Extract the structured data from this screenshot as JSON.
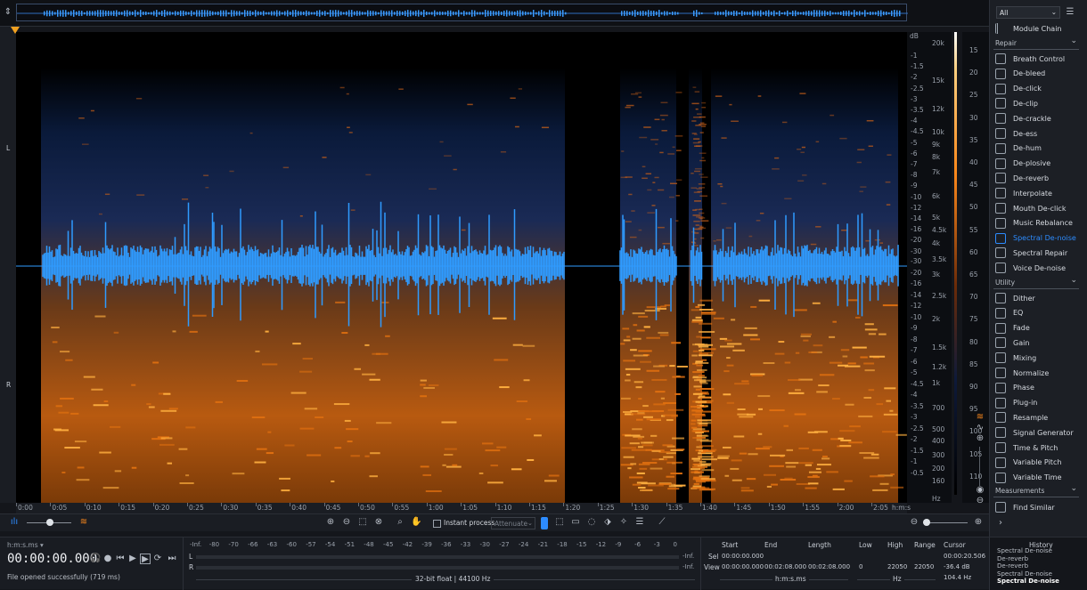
{
  "overview": {
    "toggle_icon": "expand-collapse-icon"
  },
  "channels": {
    "left": "L",
    "right": "R"
  },
  "time_ruler": {
    "ticks": [
      "0:00",
      "0:05",
      "0:10",
      "0:15",
      "0:20",
      "0:25",
      "0:30",
      "0:35",
      "0:40",
      "0:45",
      "0:50",
      "0:55",
      "1:00",
      "1:05",
      "1:10",
      "1:15",
      "1:20",
      "1:25",
      "1:30",
      "1:35",
      "1:40",
      "1:45",
      "1:50",
      "1:55",
      "2:00",
      "2:05"
    ],
    "unit": "h:m:s"
  },
  "db_axis": {
    "header": "dB",
    "upper": [
      "-1",
      "-1.5",
      "-2",
      "-2.5",
      "-3",
      "-3.5",
      "-4",
      "-4.5",
      "-5",
      "-6",
      "-7",
      "-8",
      "-9",
      "-10",
      "-12",
      "-14",
      "-16",
      "-20",
      "-30"
    ],
    "lower": [
      "-30",
      "-20",
      "-16",
      "-14",
      "-12",
      "-10",
      "-9",
      "-8",
      "-7",
      "-6",
      "-5",
      "-4.5",
      "-4",
      "-3.5",
      "-3",
      "-2.5",
      "-2",
      "-1.5",
      "-1",
      "-0.5"
    ]
  },
  "freq_axis": {
    "ticks": [
      "20k",
      "15k",
      "12k",
      "10k",
      "9k",
      "8k",
      "7k",
      "6k",
      "5k",
      "4.5k",
      "4k",
      "3.5k",
      "3k",
      "2.5k",
      "2k",
      "1.5k",
      "1.2k",
      "1k",
      "700",
      "500",
      "400",
      "300",
      "200",
      "160",
      "Hz"
    ]
  },
  "color_scale": {
    "ticks": [
      "15",
      "20",
      "25",
      "30",
      "35",
      "40",
      "45",
      "50",
      "55",
      "60",
      "65",
      "70",
      "75",
      "80",
      "85",
      "90",
      "95",
      "100",
      "105",
      "110"
    ]
  },
  "toolbar": {
    "instant_process": "Instant process",
    "attenuate": "Attenuate"
  },
  "status": {
    "time_format": "h:m:s.ms",
    "time": "00:00:00.000",
    "message": "File opened successfully (719 ms)",
    "format": "32-bit float | 44100 Hz"
  },
  "meter": {
    "scale": [
      "-Inf.",
      "-80",
      "-70",
      "-66",
      "-63",
      "-60",
      "-57",
      "-54",
      "-51",
      "-48",
      "-45",
      "-42",
      "-39",
      "-36",
      "-33",
      "-30",
      "-27",
      "-24",
      "-21",
      "-18",
      "-15",
      "-12",
      "-9",
      "-6",
      "-3",
      "0"
    ],
    "l": "L",
    "r": "R",
    "l_val": "-Inf.",
    "r_val": "-Inf."
  },
  "selection": {
    "headers": {
      "start": "Start",
      "end": "End",
      "length": "Length",
      "low": "Low",
      "high": "High",
      "range": "Range",
      "cursor": "Cursor"
    },
    "sel_label": "Sel",
    "view_label": "View",
    "sel": {
      "start": "00:00:00.000",
      "end": "",
      "length": ""
    },
    "view": {
      "start": "00:00:00.000",
      "end": "00:02:08.000",
      "length": "00:02:08.000",
      "low": "0",
      "high": "22050",
      "range": "22050"
    },
    "unit_time": "h:m:s.ms",
    "unit_hz": "Hz",
    "cursor_time": "00:00:20.506",
    "cursor_db": "-36.4 dB",
    "cursor_hz": "104.4 Hz"
  },
  "panel": {
    "filter": "All",
    "module_chain": "Module Chain",
    "repair_header": "Repair",
    "repair": [
      "Breath Control",
      "De-bleed",
      "De-click",
      "De-clip",
      "De-crackle",
      "De-ess",
      "De-hum",
      "De-plosive",
      "De-reverb",
      "Interpolate",
      "Mouth De-click",
      "Music Rebalance",
      "Spectral De-noise",
      "Spectral Repair",
      "Voice De-noise"
    ],
    "active": "Spectral De-noise",
    "utility_header": "Utility",
    "utility": [
      "Dither",
      "EQ",
      "Fade",
      "Gain",
      "Mixing",
      "Normalize",
      "Phase",
      "Plug-in",
      "Resample",
      "Signal Generator",
      "Time & Pitch",
      "Variable Pitch",
      "Variable Time"
    ],
    "measurements_header": "Measurements",
    "measurements": [
      "Find Similar"
    ]
  },
  "history": {
    "title": "History",
    "items": [
      "Spectral De-noise",
      "De-reverb",
      "De-reverb",
      "Spectral De-noise",
      "Spectral De-noise"
    ]
  },
  "colors": {
    "accent": "#2d8cff",
    "wave": "#2f9bff",
    "spectro": "#ff8a1c"
  }
}
